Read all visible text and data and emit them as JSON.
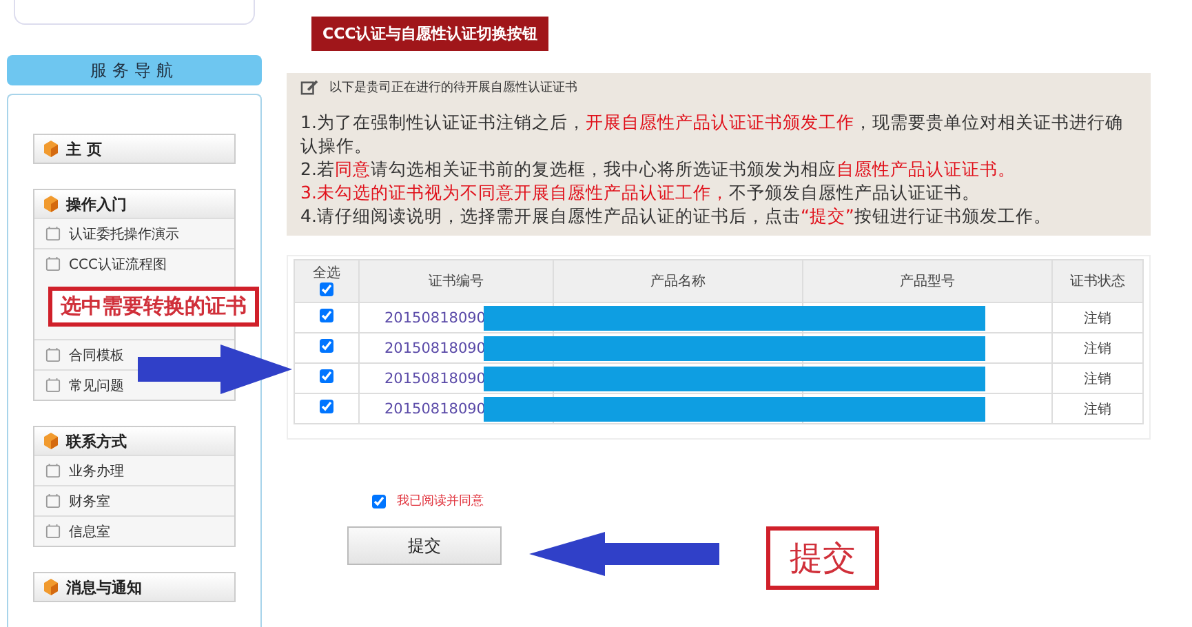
{
  "sidebar": {
    "title": "服务导航",
    "groups": [
      {
        "label": "主 页"
      },
      {
        "label": "操作入门",
        "items": [
          {
            "kind": "link",
            "label": "认证委托操作演示"
          },
          {
            "kind": "link",
            "label": "CCC认证流程图"
          },
          {
            "kind": "callout",
            "label": "选中需要转换的证书"
          },
          {
            "kind": "link",
            "label": "合同模板"
          },
          {
            "kind": "link",
            "label": "常见问题"
          }
        ]
      },
      {
        "label": "联系方式",
        "items": [
          {
            "kind": "link",
            "label": "业务办理"
          },
          {
            "kind": "link",
            "label": "财务室"
          },
          {
            "kind": "link",
            "label": "信息室"
          }
        ]
      },
      {
        "label": "消息与通知"
      }
    ]
  },
  "title_button": "CCC认证与自愿性认证切换按钮",
  "notice": {
    "heading": "以下是贵司正在进行的待开展自愿性认证证书",
    "lines": [
      [
        {
          "text": "1.为了在强制性认证证书注销之后，",
          "red": false
        },
        {
          "text": "开展自愿性产品认证证书颁发工作",
          "red": true
        },
        {
          "text": "，现需要贵单位对相关证书进行确认操作。",
          "red": false
        }
      ],
      [
        {
          "text": "2.若",
          "red": false
        },
        {
          "text": "同意",
          "red": true
        },
        {
          "text": "请勾选相关证书前的复选框，我中心将所选证书颁发为相应",
          "red": false
        },
        {
          "text": "自愿性产品认证证书。",
          "red": true
        }
      ],
      [
        {
          "text": "3.未勾选的证书视为不同意开展自愿性产品认证工作，",
          "red": true
        },
        {
          "text": "不予颁发自愿性产品认证证书。",
          "red": false
        }
      ],
      [
        {
          "text": "4.请仔细阅读说明，选择需开展自愿性产品认证的证书后，点击",
          "red": false
        },
        {
          "text": "“提交”",
          "red": true
        },
        {
          "text": "按钮进行证书颁发工作。",
          "red": false
        }
      ]
    ]
  },
  "table": {
    "select_all": {
      "label": "全选",
      "checked": true
    },
    "columns": [
      "证书编号",
      "产品名称",
      "产品型号",
      "证书状态"
    ],
    "rows": [
      {
        "checked": true,
        "number": "20150818090",
        "status": "注销"
      },
      {
        "checked": true,
        "number": "20150818090",
        "status": "注销"
      },
      {
        "checked": true,
        "number": "20150818090",
        "status": "注销"
      },
      {
        "checked": true,
        "number": "20150818090",
        "status": "注销"
      }
    ]
  },
  "agree": {
    "label": "我已阅读并同意",
    "checked": true
  },
  "submit_button": "提交",
  "callout": "提交"
}
